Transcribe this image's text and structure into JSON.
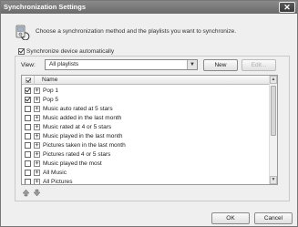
{
  "window": {
    "title": "Synchronization Settings",
    "close_label": "✕"
  },
  "intro": {
    "text": "Choose a synchronization method and the playlists you want to synchronize."
  },
  "sync_group": {
    "auto_sync_label": "Synchronize device automatically",
    "auto_sync_checked": true
  },
  "view": {
    "label": "View:",
    "selected": "All playlists"
  },
  "buttons": {
    "new": "New",
    "edit": "Edit...",
    "ok": "OK",
    "cancel": "Cancel"
  },
  "list": {
    "column_name": "Name",
    "items": [
      {
        "label": "Pop 1",
        "checked": true
      },
      {
        "label": "Pop 5",
        "checked": true
      },
      {
        "label": "Music auto rated at 5 stars",
        "checked": false
      },
      {
        "label": "Music added in the last month",
        "checked": false
      },
      {
        "label": "Music rated at 4 or 5 stars",
        "checked": false
      },
      {
        "label": "Music played in the last month",
        "checked": false
      },
      {
        "label": "Pictures taken in the last month",
        "checked": false
      },
      {
        "label": "Pictures rated 4 or 5 stars",
        "checked": false
      },
      {
        "label": "Music played the most",
        "checked": false
      },
      {
        "label": "All Music",
        "checked": false
      },
      {
        "label": "All Pictures",
        "checked": false
      }
    ]
  },
  "icons": {
    "intro": "sync-device-icon",
    "move_up": "move-up-icon",
    "move_down": "move-down-icon"
  }
}
